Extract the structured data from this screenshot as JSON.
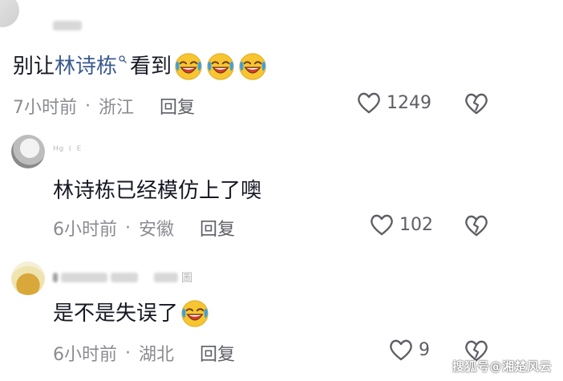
{
  "comments": [
    {
      "text_before": "别让",
      "highlight": "林诗栋",
      "text_after": "看到",
      "emoji_count": 3,
      "time": "7小时前",
      "location": "浙江",
      "reply_label": "回复",
      "likes": "1249"
    },
    {
      "username_visible": "ᴴᵍ ⁽ ᴱ",
      "text": "林诗栋已经模仿上了噢",
      "time": "6小时前",
      "location": "安徽",
      "reply_label": "回复",
      "likes": "102"
    },
    {
      "username_visible": "圖",
      "text": "是不是失误了",
      "emoji_count": 1,
      "time": "6小时前",
      "location": "湖北",
      "reply_label": "回复",
      "likes": "9"
    }
  ],
  "separator": "·",
  "watermark": "搜狐号@湘楚风云",
  "colors": {
    "highlight": "#3b5b8f",
    "meta": "#8a8b91",
    "text": "#161823",
    "emoji_face": "#f7c531",
    "emoji_mouth": "#d93a2b",
    "emoji_tears": "#3aa0e6"
  },
  "icons": {
    "like": "heart-outline-icon",
    "dislike": "broken-heart-icon",
    "search": "search-icon",
    "emoji": "crying-laughing-emoji-icon"
  }
}
